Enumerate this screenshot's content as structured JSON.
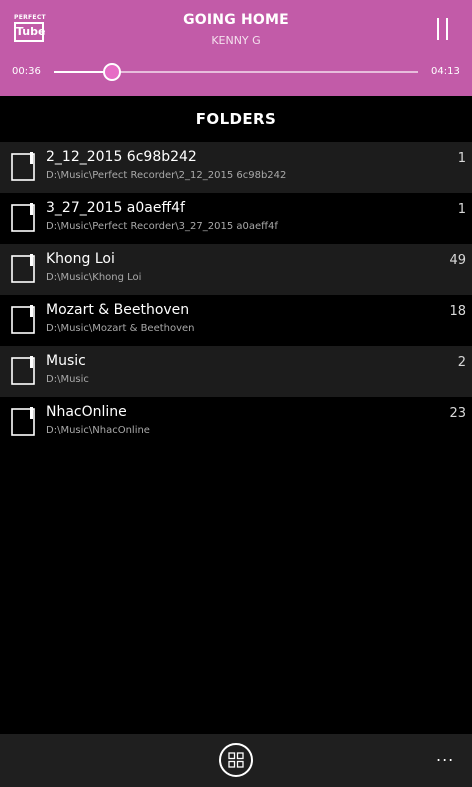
{
  "player": {
    "logo_top": "PERFECT",
    "logo_main": "Tube",
    "title": "GOING HOME",
    "artist": "KENNY G",
    "elapsed": "00:36",
    "total": "04:13",
    "progress": 0.16
  },
  "section_title": "FOLDERS",
  "folders": [
    {
      "name": "2_12_2015 6c98b242",
      "path": "D:\\Music\\Perfect Recorder\\2_12_2015 6c98b242",
      "count": "1"
    },
    {
      "name": "3_27_2015 a0aeff4f",
      "path": "D:\\Music\\Perfect Recorder\\3_27_2015 a0aeff4f",
      "count": "1"
    },
    {
      "name": "Khong Loi",
      "path": "D:\\Music\\Khong Loi",
      "count": "49"
    },
    {
      "name": "Mozart & Beethoven",
      "path": "D:\\Music\\Mozart & Beethoven",
      "count": "18"
    },
    {
      "name": "Music",
      "path": "D:\\Music",
      "count": "2"
    },
    {
      "name": "NhacOnline",
      "path": "D:\\Music\\NhacOnline",
      "count": "23"
    }
  ],
  "bottom_bar": {
    "more_label": "..."
  },
  "colors": {
    "accent": "#c25ba8",
    "thumb": "#e66cc5",
    "row_alt": "#1c1c1c"
  }
}
